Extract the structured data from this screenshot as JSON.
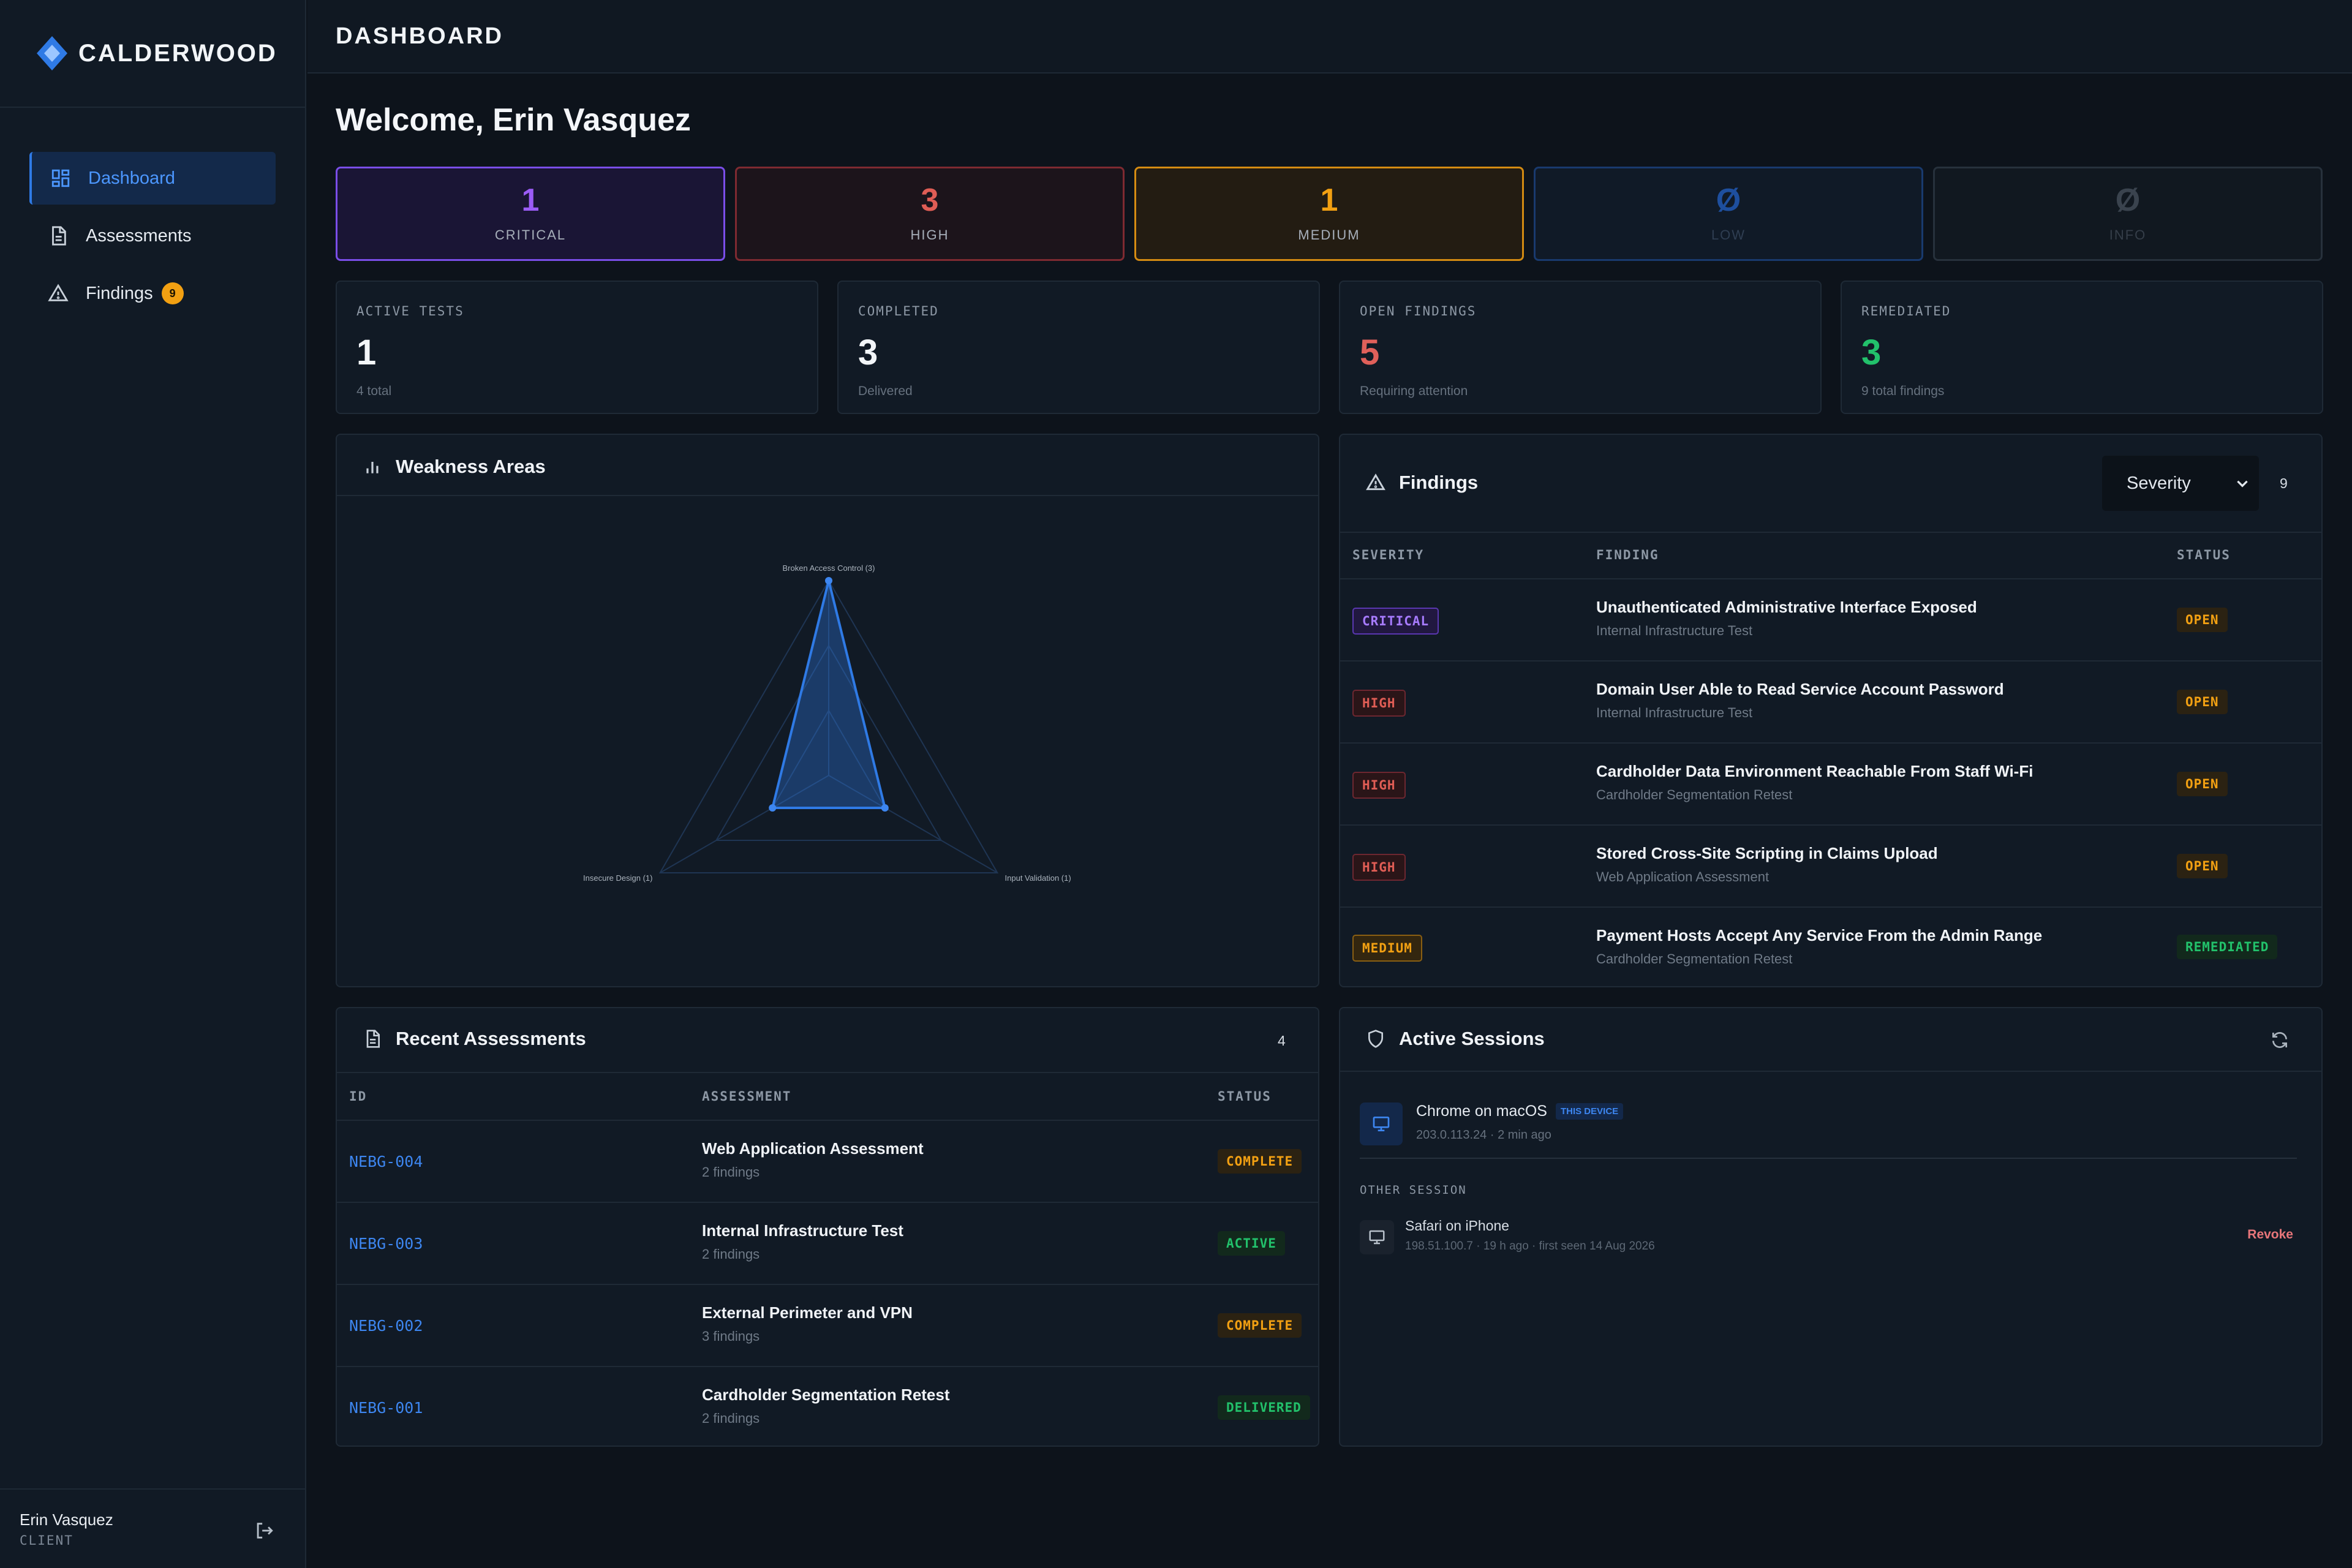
{
  "app": {
    "brand": "CALDERWOOD",
    "page_title": "DASHBOARD"
  },
  "sidebar": {
    "items": [
      {
        "label": "Dashboard",
        "icon": "grid-icon",
        "active": true
      },
      {
        "label": "Assessments",
        "icon": "document-icon"
      },
      {
        "label": "Findings",
        "icon": "warning-icon",
        "badge": "9"
      }
    ],
    "user": {
      "name": "Erin Vasquez",
      "role": "CLIENT"
    }
  },
  "welcome": "Welcome, Erin Vasquez",
  "severity_cards": [
    {
      "count": "1",
      "label": "CRITICAL",
      "color": "#9b5cf6"
    },
    {
      "count": "3",
      "label": "HIGH",
      "color": "#e05d55"
    },
    {
      "count": "1",
      "label": "MEDIUM",
      "color": "#f2a012"
    },
    {
      "count": "0",
      "label": "LOW",
      "color": "#1e4f9e"
    },
    {
      "count": "0",
      "label": "INFO",
      "color": "#3a434e"
    }
  ],
  "stats": [
    {
      "label": "ACTIVE TESTS",
      "value": "1",
      "sub": "4 total",
      "color": "#f2f5f8"
    },
    {
      "label": "COMPLETED",
      "value": "3",
      "sub": "Delivered",
      "color": "#f2f5f8"
    },
    {
      "label": "OPEN FINDINGS",
      "value": "5",
      "sub": "Requiring attention",
      "color": "#e0605a"
    },
    {
      "label": "REMEDIATED",
      "value": "3",
      "sub": "9 total findings",
      "color": "#22c16b"
    }
  ],
  "weakness": {
    "title": "Weakness Areas",
    "chart_data": {
      "type": "radar",
      "categories": [
        "Broken Access Control (3)",
        "Input Validation (1)",
        "Insecure Design (1)"
      ],
      "values": [
        3,
        1,
        1
      ],
      "max": 3
    }
  },
  "findings": {
    "title": "Findings",
    "filter": "Severity",
    "count": "9",
    "headers": [
      "SEVERITY",
      "FINDING",
      "STATUS"
    ],
    "rows": [
      {
        "severity": "CRITICAL",
        "title": "Unauthenticated Administrative Interface Exposed",
        "assessment": "Internal Infrastructure Test",
        "status": "OPEN"
      },
      {
        "severity": "HIGH",
        "title": "Domain User Able to Read Service Account Password",
        "assessment": "Internal Infrastructure Test",
        "status": "OPEN"
      },
      {
        "severity": "HIGH",
        "title": "Cardholder Data Environment Reachable From Staff Wi-Fi",
        "assessment": "Cardholder Segmentation Retest",
        "status": "OPEN"
      },
      {
        "severity": "HIGH",
        "title": "Stored Cross-Site Scripting in Claims Upload",
        "assessment": "Web Application Assessment",
        "status": "OPEN"
      },
      {
        "severity": "MEDIUM",
        "title": "Payment Hosts Accept Any Service From the Admin Range",
        "assessment": "Cardholder Segmentation Retest",
        "status": "REMEDIATED"
      }
    ]
  },
  "assessments": {
    "title": "Recent Assessments",
    "count": "4",
    "headers": [
      "ID",
      "ASSESSMENT",
      "STATUS"
    ],
    "rows": [
      {
        "id": "NEBG-004",
        "name": "Web Application Assessment",
        "findings": "2 findings",
        "status": "COMPLETE"
      },
      {
        "id": "NEBG-003",
        "name": "Internal Infrastructure Test",
        "findings": "2 findings",
        "status": "ACTIVE"
      },
      {
        "id": "NEBG-002",
        "name": "External Perimeter and VPN",
        "findings": "3 findings",
        "status": "COMPLETE"
      },
      {
        "id": "NEBG-001",
        "name": "Cardholder Segmentation Retest",
        "findings": "2 findings",
        "status": "DELIVERED"
      }
    ]
  },
  "sessions": {
    "title": "Active Sessions",
    "current": {
      "device": "Chrome on macOS",
      "tag": "THIS DEVICE",
      "meta": "203.0.113.24 · 2 min ago"
    },
    "other_label": "OTHER SESSION",
    "other": {
      "device": "Safari on iPhone",
      "meta": "198.51.100.7 · 19 h ago · first seen 14 Aug 2026",
      "action": "Revoke"
    }
  }
}
